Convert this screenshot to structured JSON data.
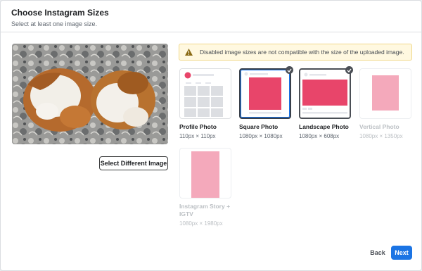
{
  "dialog": {
    "title": "Choose Instagram Sizes",
    "subtitle": "Select at least one image size."
  },
  "warning": {
    "text": "Disabled image sizes are not compatible with the size of the uploaded image."
  },
  "select_button": "Select Different Image",
  "sizes": [
    {
      "label": "Profile Photo",
      "dims": "110px × 110px",
      "selected": false,
      "disabled": false
    },
    {
      "label": "Square Photo",
      "dims": "1080px × 1080px",
      "selected": true,
      "disabled": false
    },
    {
      "label": "Landscape Photo",
      "dims": "1080px × 608px",
      "selected": true,
      "disabled": false
    },
    {
      "label": "Vertical Photo",
      "dims": "1080px × 1350px",
      "selected": false,
      "disabled": true
    },
    {
      "label": "Instagram Story + IGTV",
      "dims": "1080px × 1980px",
      "selected": false,
      "disabled": true
    }
  ],
  "footer": {
    "back": "Back",
    "next": "Next"
  },
  "colors": {
    "accent_pink": "#e8456a",
    "disabled_pink": "#f4a9bb",
    "primary_blue": "#1b74e4",
    "warning_bg": "#fff8e0"
  }
}
